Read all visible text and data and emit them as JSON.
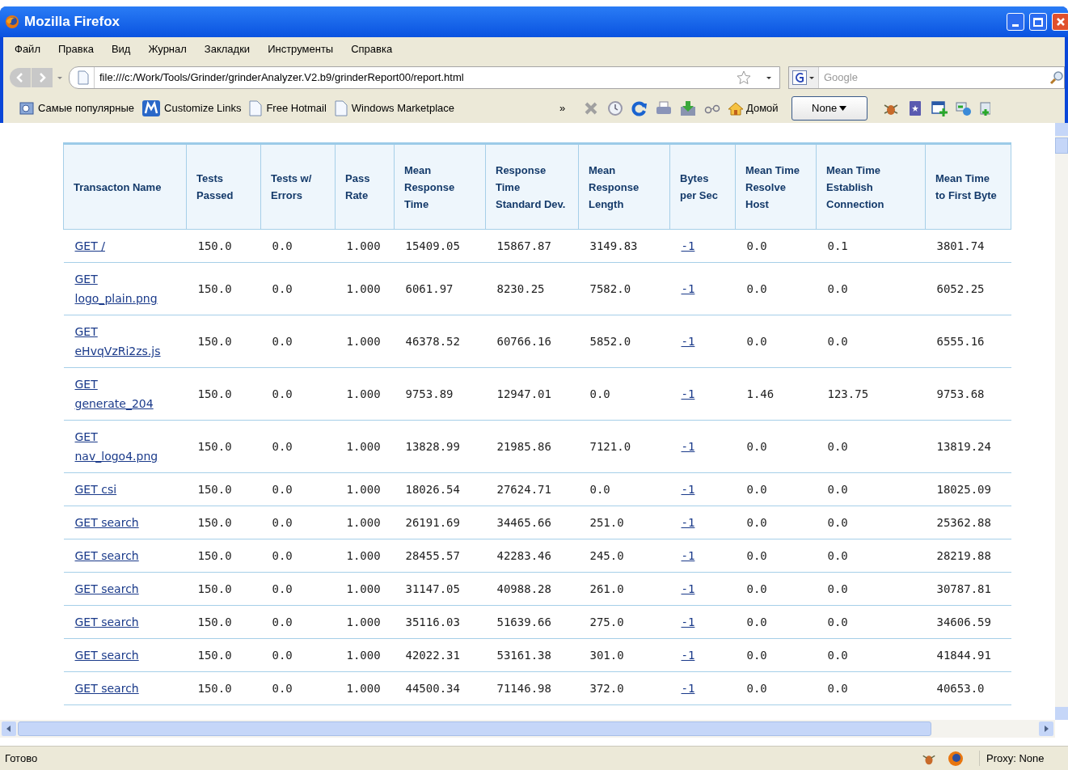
{
  "window": {
    "title": "Mozilla Firefox"
  },
  "menu": [
    "Файл",
    "Правка",
    "Вид",
    "Журнал",
    "Закладки",
    "Инструменты",
    "Справка"
  ],
  "address_bar": {
    "value": "file:///c:/Work/Tools/Grinder/grinderAnalyzer.V2.b9/grinderReport00/report.html"
  },
  "search": {
    "placeholder": "Google"
  },
  "bookmarks": [
    {
      "label": "Самые популярные",
      "kind": "popular"
    },
    {
      "label": "Customize Links",
      "kind": "brand"
    },
    {
      "label": "Free Hotmail",
      "kind": "page"
    },
    {
      "label": "Windows Marketplace",
      "kind": "page"
    }
  ],
  "bookmarks_overflow": "»",
  "toolbar": {
    "home": "Домой",
    "proxy_menu": "None"
  },
  "table": {
    "columns": [
      "Transacton Name",
      "Tests Passed",
      "Tests w/ Errors",
      "Pass Rate",
      "Mean Response Time",
      "Response Time Standard Dev.",
      "Mean Response Length",
      "Bytes per Sec",
      "Mean Time Resolve Host",
      "Mean Time Establish Connection",
      "Mean Time to First Byte"
    ],
    "rows": [
      {
        "cells": [
          "GET /",
          "150.0",
          "0.0",
          "1.000",
          "15409.05",
          "15867.87",
          "3149.83",
          "-1",
          "0.0",
          "0.1",
          "3801.74"
        ]
      },
      {
        "cells": [
          "GET logo_plain.png",
          "150.0",
          "0.0",
          "1.000",
          "6061.97",
          "8230.25",
          "7582.0",
          "-1",
          "0.0",
          "0.0",
          "6052.25"
        ]
      },
      {
        "cells": [
          "GET eHvqVzRi2zs.js",
          "150.0",
          "0.0",
          "1.000",
          "46378.52",
          "60766.16",
          "5852.0",
          "-1",
          "0.0",
          "0.0",
          "6555.16"
        ]
      },
      {
        "cells": [
          "GET generate_204",
          "150.0",
          "0.0",
          "1.000",
          "9753.89",
          "12947.01",
          "0.0",
          "-1",
          "1.46",
          "123.75",
          "9753.68"
        ]
      },
      {
        "cells": [
          "GET nav_logo4.png",
          "150.0",
          "0.0",
          "1.000",
          "13828.99",
          "21985.86",
          "7121.0",
          "-1",
          "0.0",
          "0.0",
          "13819.24"
        ]
      },
      {
        "cells": [
          "GET csi",
          "150.0",
          "0.0",
          "1.000",
          "18026.54",
          "27624.71",
          "0.0",
          "-1",
          "0.0",
          "0.0",
          "18025.09"
        ]
      },
      {
        "cells": [
          "GET search",
          "150.0",
          "0.0",
          "1.000",
          "26191.69",
          "34465.66",
          "251.0",
          "-1",
          "0.0",
          "0.0",
          "25362.88"
        ]
      },
      {
        "cells": [
          "GET search",
          "150.0",
          "0.0",
          "1.000",
          "28455.57",
          "42283.46",
          "245.0",
          "-1",
          "0.0",
          "0.0",
          "28219.88"
        ]
      },
      {
        "cells": [
          "GET search",
          "150.0",
          "0.0",
          "1.000",
          "31147.05",
          "40988.28",
          "261.0",
          "-1",
          "0.0",
          "0.0",
          "30787.81"
        ]
      },
      {
        "cells": [
          "GET search",
          "150.0",
          "0.0",
          "1.000",
          "35116.03",
          "51639.66",
          "275.0",
          "-1",
          "0.0",
          "0.0",
          "34606.59"
        ]
      },
      {
        "cells": [
          "GET search",
          "150.0",
          "0.0",
          "1.000",
          "42022.31",
          "53161.38",
          "301.0",
          "-1",
          "0.0",
          "0.0",
          "41844.91"
        ]
      },
      {
        "cells": [
          "GET search",
          "150.0",
          "0.0",
          "1.000",
          "44500.34",
          "71146.98",
          "372.0",
          "-1",
          "0.0",
          "0.0",
          "40653.0"
        ]
      }
    ]
  },
  "status_bar": {
    "text": "Готово",
    "proxy": "Proxy: None"
  }
}
